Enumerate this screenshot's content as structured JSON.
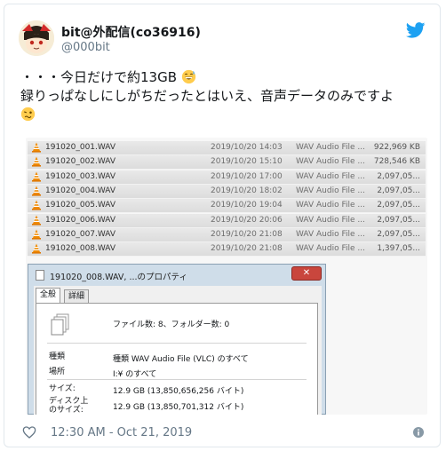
{
  "user": {
    "display_name": "bit@外配信(co36916)",
    "handle": "@000bit"
  },
  "tweet": {
    "line1": "・・・今日だけで約13GB",
    "line2": "録りっぱなしにしがちだったとはいえ、音声データのみですよ"
  },
  "files": [
    {
      "name": "191020_001.WAV",
      "date": "2019/10/20 14:03",
      "type": "WAV Audio File ...",
      "size": "922,969 KB"
    },
    {
      "name": "191020_002.WAV",
      "date": "2019/10/20 15:10",
      "type": "WAV Audio File ...",
      "size": "728,546 KB"
    },
    {
      "name": "191020_003.WAV",
      "date": "2019/10/20 17:00",
      "type": "WAV Audio File ...",
      "size": "2,097,05..."
    },
    {
      "name": "191020_004.WAV",
      "date": "2019/10/20 18:02",
      "type": "WAV Audio File ...",
      "size": "2,097,05..."
    },
    {
      "name": "191020_005.WAV",
      "date": "2019/10/20 19:04",
      "type": "WAV Audio File ...",
      "size": "2,097,05..."
    },
    {
      "name": "191020_006.WAV",
      "date": "2019/10/20 20:06",
      "type": "WAV Audio File ...",
      "size": "2,097,05..."
    },
    {
      "name": "191020_007.WAV",
      "date": "2019/10/20 21:08",
      "type": "WAV Audio File ...",
      "size": "2,097,05..."
    },
    {
      "name": "191020_008.WAV",
      "date": "2019/10/20 21:08",
      "type": "WAV Audio File ...",
      "size": "1,397,05..."
    }
  ],
  "dialog": {
    "title": "191020_008.WAV, ...のプロパティ",
    "close": "✕",
    "tabs": [
      "全般",
      "詳細"
    ],
    "count_text": "ファイル数: 8、フォルダー数: 0",
    "props": [
      {
        "label": "種類",
        "value": "種類 WAV Audio File (VLC) のすべて"
      },
      {
        "label": "場所",
        "value": "I:¥ のすべて"
      },
      {
        "label": "サイズ:",
        "value": "12.9 GB (13,850,656,256 バイト)"
      },
      {
        "label": "ディスク上\nのサイズ:",
        "value": "12.9 GB (13,850,701,312 バイト)"
      }
    ]
  },
  "footer": {
    "timestamp": "12:30 AM - Oct 21, 2019"
  },
  "colors": {
    "twitter_blue": "#1da1f2",
    "muted": "#657786",
    "vlc_orange": "#f08a00",
    "dialog_close": "#c9463d"
  },
  "icons": [
    "avatar-image",
    "twitter-bird-icon",
    "grin-sweat-emoji",
    "woozy-emoji",
    "vlc-cone-icon",
    "document-icon",
    "multiple-files-icon",
    "heart-icon",
    "info-icon"
  ]
}
